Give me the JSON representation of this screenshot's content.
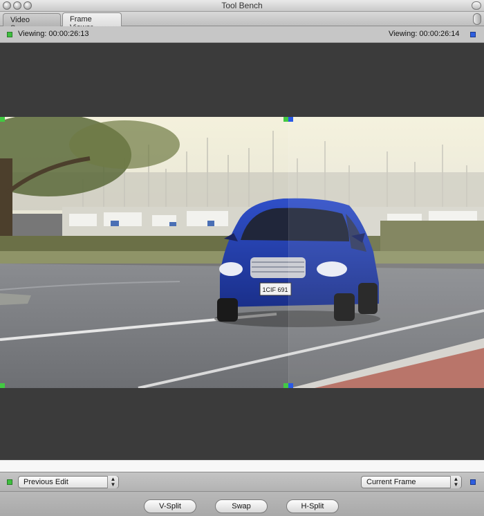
{
  "window": {
    "title": "Tool Bench"
  },
  "tabs": [
    {
      "label": "Video Scopes",
      "active": false
    },
    {
      "label": "Frame Viewer",
      "active": true
    }
  ],
  "viewer": {
    "left_viewing": "Viewing: 00:00:26:13",
    "right_viewing": "Viewing: 00:00:26:14",
    "left_marker_color": "#3fbf3f",
    "right_marker_color": "#2f5fe0"
  },
  "video": {
    "plate_text": "1CIF 691"
  },
  "controls": {
    "left_select": "Previous Edit",
    "right_select": "Current Frame",
    "v_split": "V-Split",
    "swap": "Swap",
    "h_split": "H-Split"
  },
  "icons": {
    "close": "close-button-icon",
    "minimize": "minimize-button-icon",
    "zoom": "zoom-button-icon",
    "popup": "popup-arrows-icon"
  }
}
